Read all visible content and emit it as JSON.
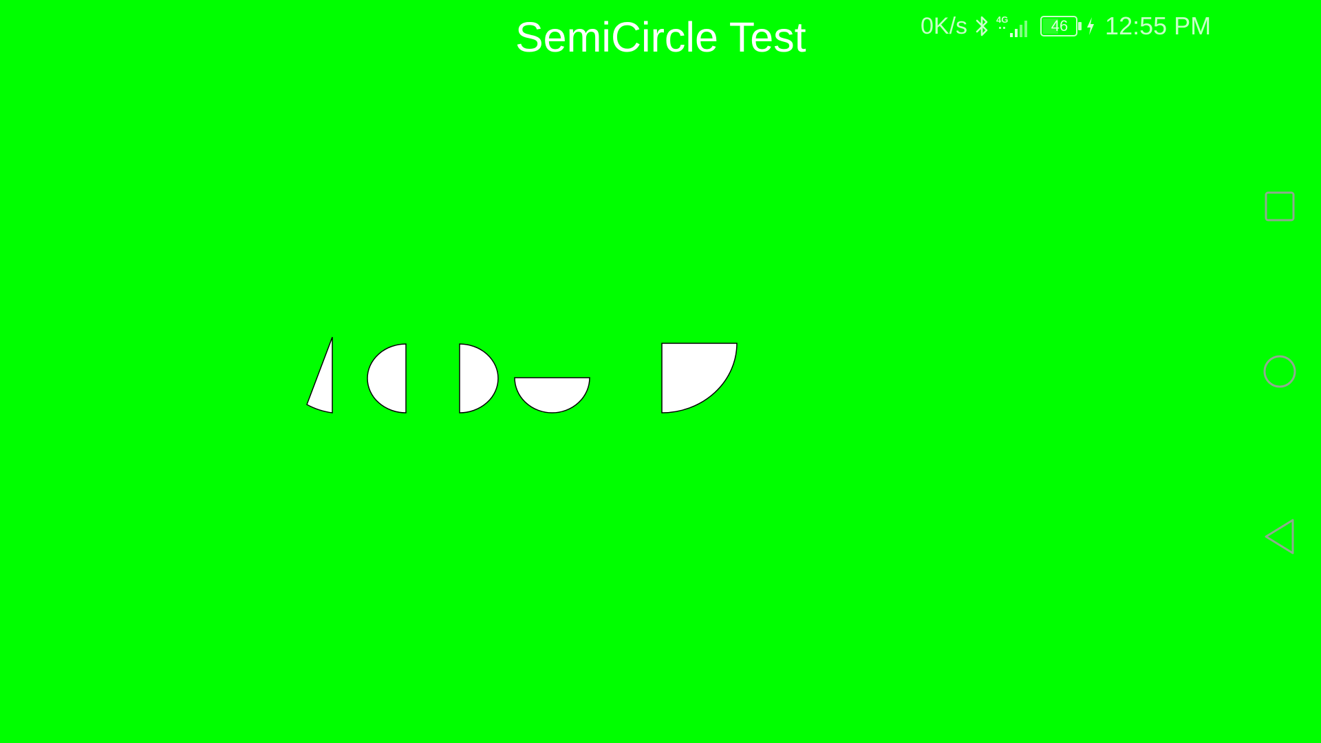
{
  "app": {
    "title": "SemiCircle Test"
  },
  "status_bar": {
    "network_speed": "0K/s",
    "network_type": "4G",
    "battery_level": "46",
    "time": "12:55 PM",
    "icons": [
      "bluetooth-icon",
      "signal-icon",
      "battery-icon",
      "charging-icon"
    ]
  },
  "canvas": {
    "shapes": [
      "sector-shape",
      "left-semicircle-shape",
      "right-semicircle-shape",
      "bottom-semicircle-shape",
      "quarter-circle-shape"
    ]
  },
  "nav_bar": {
    "buttons": [
      "recent-apps-button",
      "home-button",
      "back-button"
    ]
  },
  "colors": {
    "background": "#00ff00",
    "shape_fill": "#ffffff",
    "shape_stroke": "#000000",
    "text": "#ffffff"
  }
}
